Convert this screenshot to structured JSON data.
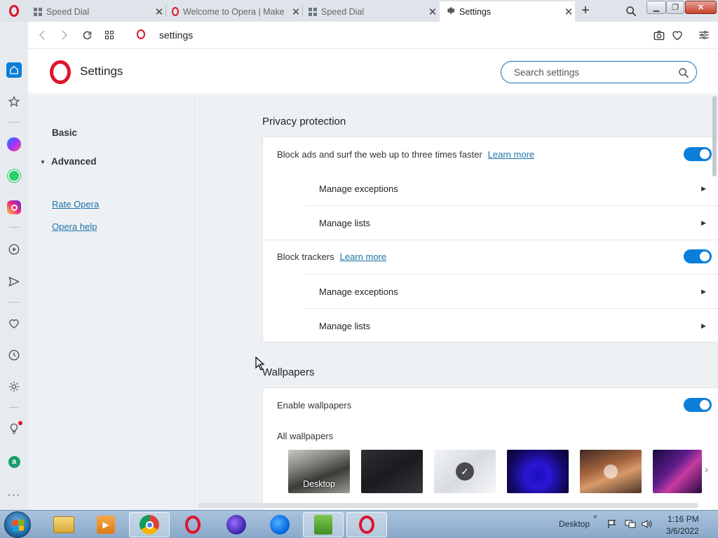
{
  "browser": {
    "tabs": [
      {
        "title": "Speed Dial",
        "icon": "speed-dial-icon",
        "active": false
      },
      {
        "title": "Welcome to Opera | Make",
        "icon": "opera-icon",
        "active": false
      },
      {
        "title": "Speed Dial",
        "icon": "speed-dial-icon",
        "active": false
      },
      {
        "title": "Settings",
        "icon": "gear-icon",
        "active": true
      }
    ],
    "address": "settings"
  },
  "settings": {
    "title": "Settings",
    "search_placeholder": "Search settings"
  },
  "leftmenu": {
    "basic": "Basic",
    "advanced": "Advanced",
    "rate": "Rate Opera",
    "help": "Opera help"
  },
  "privacy": {
    "title": "Privacy protection",
    "block_ads": "Block ads and surf the web up to three times faster",
    "block_trackers": "Block trackers",
    "learn_more": "Learn more",
    "manage_exceptions": "Manage exceptions",
    "manage_lists": "Manage lists",
    "block_ads_enabled": true,
    "block_trackers_enabled": true
  },
  "wallpapers": {
    "title": "Wallpapers",
    "enable_label": "Enable wallpapers",
    "enabled": true,
    "all_label": "All wallpapers",
    "items": [
      {
        "label": "Desktop",
        "selected": false
      },
      {
        "label": "",
        "selected": false
      },
      {
        "label": "",
        "selected": true
      },
      {
        "label": "",
        "selected": false
      },
      {
        "label": "",
        "selected": false
      },
      {
        "label": "",
        "selected": false
      }
    ]
  },
  "taskbar": {
    "desktop_label": "Desktop",
    "time": "1:16 PM",
    "date": "3/6/2022"
  },
  "colors": {
    "accent": "#0a7ed9",
    "link": "#1a73a8",
    "opera_red": "#e0142a"
  }
}
